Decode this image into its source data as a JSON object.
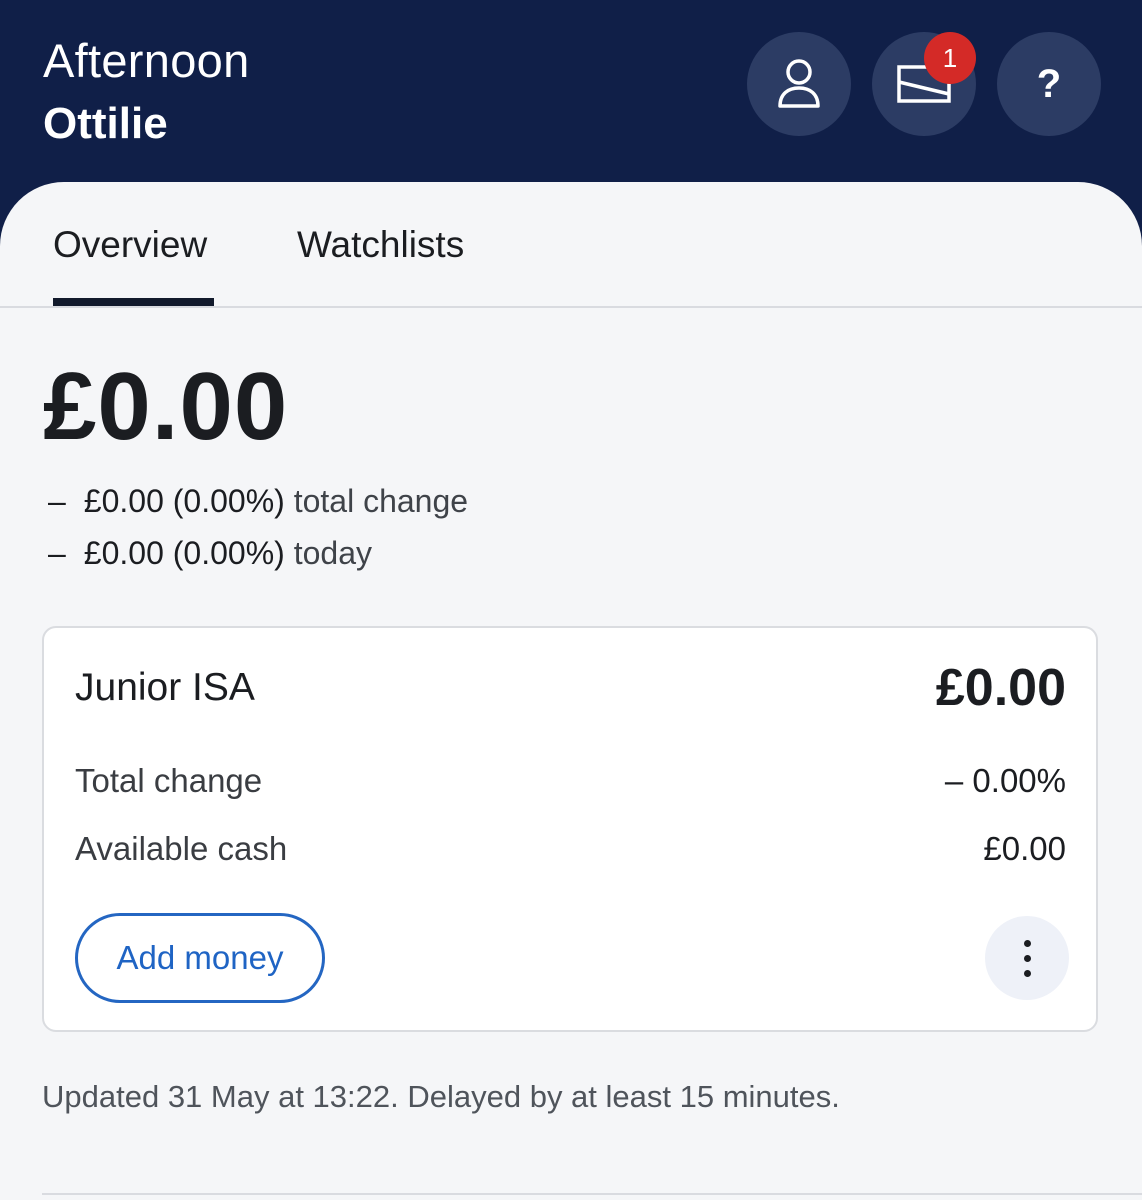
{
  "header": {
    "greeting": "Afternoon",
    "name": "Ottilie",
    "profile_icon": "person-icon",
    "inbox_icon": "envelope-icon",
    "inbox_badge": "1",
    "help_label": "?"
  },
  "tabs": [
    {
      "label": "Overview",
      "active": true
    },
    {
      "label": "Watchlists",
      "active": false
    }
  ],
  "portfolio": {
    "total_value": "£0.00",
    "total_change": {
      "dash": "–",
      "amount": "£0.00 (0.00%)",
      "label": "total change"
    },
    "today_change": {
      "dash": "–",
      "amount": "£0.00 (0.00%)",
      "label": "today"
    }
  },
  "account_card": {
    "title": "Junior ISA",
    "value": "£0.00",
    "rows": [
      {
        "label": "Total change",
        "value": "– 0.00%"
      },
      {
        "label": "Available cash",
        "value": "£0.00"
      }
    ],
    "add_money_label": "Add money",
    "more_icon": "more-vertical-icon"
  },
  "footer": {
    "note": "Updated 31 May at 13:22. Delayed by at least 15 minutes."
  },
  "colors": {
    "header_bg": "#101f48",
    "header_button_bg": "#2c3c64",
    "badge": "#d42a27",
    "accent_blue": "#2466c2",
    "page_bg": "#f5f6f8"
  }
}
